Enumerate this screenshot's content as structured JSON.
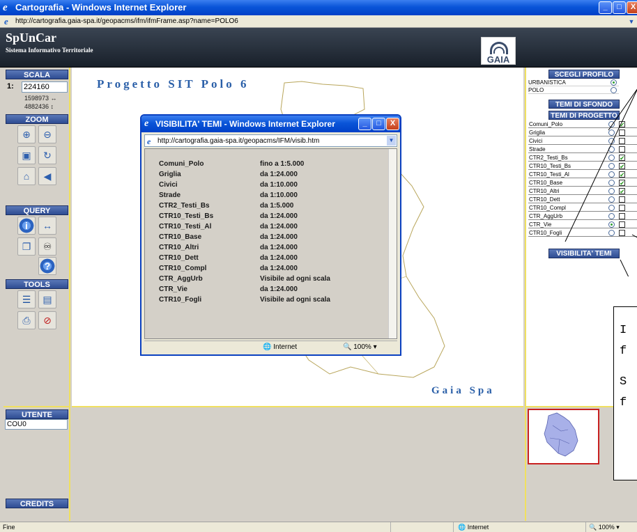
{
  "window": {
    "title": "Cartografia - Windows Internet Explorer",
    "address": "http://cartografia.gaia-spa.it/geopacms/ifm/ifmFrame.asp?name=POLO6"
  },
  "header": {
    "title": "SpUnCar",
    "subtitle": "Sistema Informativo Territoriale",
    "logo_text": "GAIA"
  },
  "left": {
    "scala_label": "SCALA",
    "scala_prefix": "1:",
    "scala_value": "224160",
    "coord_x": "1598973 ↔",
    "coord_y": "4882436 ↕",
    "zoom_label": "ZOOM",
    "query_label": "QUERY",
    "tools_label": "TOOLS"
  },
  "map": {
    "title": "Progetto SIT Polo 6",
    "credit": "Gaia Spa"
  },
  "right": {
    "profile_head": "SCEGLI PROFILO",
    "profiles": [
      {
        "label": "URBANISTICA",
        "selected": true
      },
      {
        "label": "POLO",
        "selected": false
      }
    ],
    "sfondo_head": "TEMI DI SFONDO",
    "progetto_head": "TEMI DI PROGETTO",
    "themes": [
      {
        "label": "Comuni_Polo",
        "radio": false,
        "check": true
      },
      {
        "label": "Griglia",
        "radio": false,
        "check": false
      },
      {
        "label": "Civici",
        "radio": false,
        "check": false
      },
      {
        "label": "Strade",
        "radio": false,
        "check": false
      },
      {
        "label": "CTR2_Testi_Bs",
        "radio": false,
        "check": true
      },
      {
        "label": "CTR10_Testi_Bs",
        "radio": false,
        "check": true
      },
      {
        "label": "CTR10_Testi_Al",
        "radio": false,
        "check": true
      },
      {
        "label": "CTR10_Base",
        "radio": false,
        "check": true
      },
      {
        "label": "CTR10_Altri",
        "radio": false,
        "check": true
      },
      {
        "label": "CTR10_Dett",
        "radio": false,
        "check": false
      },
      {
        "label": "CTR10_Compl",
        "radio": false,
        "check": false
      },
      {
        "label": "CTR_AggUrb",
        "radio": false,
        "check": false
      },
      {
        "label": "CTR_Vie",
        "radio": true,
        "check": false
      },
      {
        "label": "CTR10_Fogli",
        "radio": false,
        "check": false
      }
    ],
    "visibility_button": "VISIBILITA' TEMI"
  },
  "bottom": {
    "utente_label": "UTENTE",
    "utente_value": "COU0",
    "credits_label": "CREDITS"
  },
  "annotation": {
    "lines": [
      "I",
      "f",
      "S",
      "f"
    ]
  },
  "status": {
    "left": "Fine",
    "zone": "Internet",
    "zoom": "100%"
  },
  "popup": {
    "title": "VISIBILITA' TEMI - Windows Internet Explorer",
    "address": "http://cartografia.gaia-spa.it/geopacms/IFM/visib.htm",
    "rows": [
      {
        "name": "Comuni_Polo",
        "scale": "fino a 1:5.000"
      },
      {
        "name": "Griglia",
        "scale": "da 1:24.000"
      },
      {
        "name": "Civici",
        "scale": "da 1:10.000"
      },
      {
        "name": "Strade",
        "scale": "da 1:10.000"
      },
      {
        "name": "CTR2_Testi_Bs",
        "scale": "da 1:5.000"
      },
      {
        "name": "CTR10_Testi_Bs",
        "scale": "da 1:24.000"
      },
      {
        "name": "CTR10_Testi_Al",
        "scale": "da 1:24.000"
      },
      {
        "name": "CTR10_Base",
        "scale": "da 1:24.000"
      },
      {
        "name": "CTR10_Altri",
        "scale": "da 1:24.000"
      },
      {
        "name": "CTR10_Dett",
        "scale": "da 1:24.000"
      },
      {
        "name": "CTR10_Compl",
        "scale": "da 1:24.000"
      },
      {
        "name": "CTR_AggUrb",
        "scale": "Visibile ad ogni scala"
      },
      {
        "name": "CTR_Vie",
        "scale": "da 1:24.000"
      },
      {
        "name": "CTR10_Fogli",
        "scale": "Visibile ad ogni scala"
      }
    ],
    "status_zone": "Internet",
    "status_zoom": "100%"
  }
}
